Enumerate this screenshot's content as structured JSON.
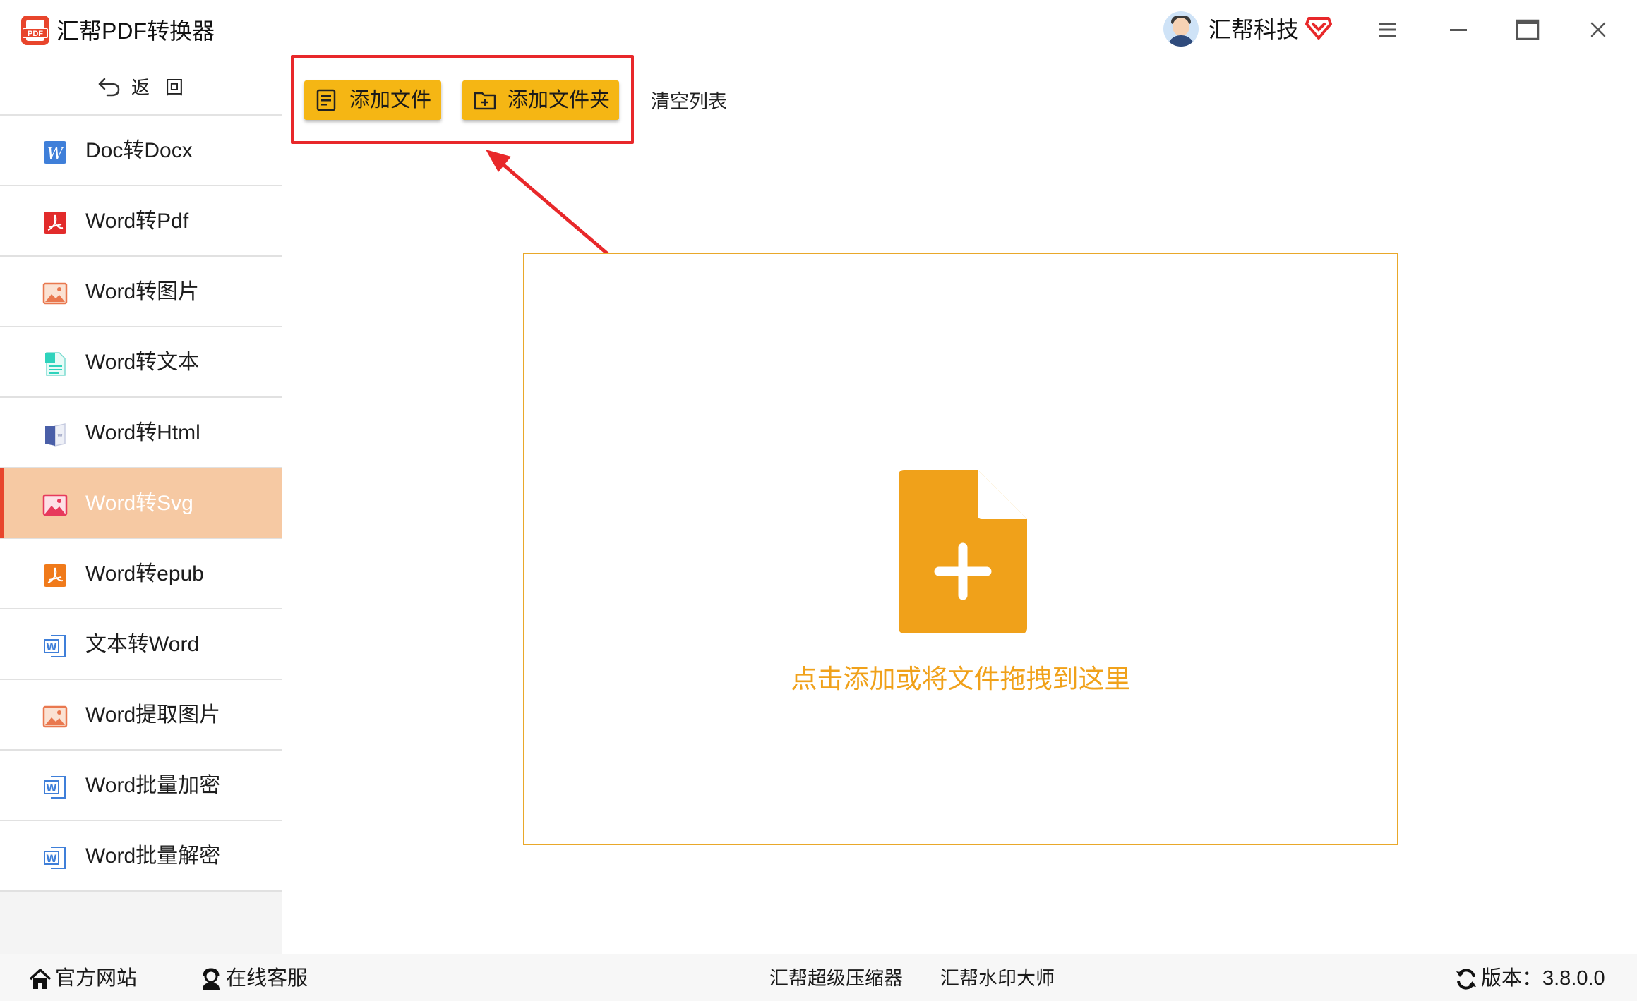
{
  "app": {
    "title": "汇帮PDF转换器",
    "logo_text": "PDF"
  },
  "user": {
    "name": "汇帮科技"
  },
  "sidebar": {
    "back_label": "返回",
    "items": [
      {
        "label": "Doc转Docx",
        "icon": "word-icon"
      },
      {
        "label": "Word转Pdf",
        "icon": "pdf-icon"
      },
      {
        "label": "Word转图片",
        "icon": "image-icon"
      },
      {
        "label": "Word转文本",
        "icon": "text-file-icon"
      },
      {
        "label": "Word转Html",
        "icon": "html-book-icon"
      },
      {
        "label": "Word转Svg",
        "icon": "image-icon",
        "active": true
      },
      {
        "label": "Word转epub",
        "icon": "epub-icon"
      },
      {
        "label": "文本转Word",
        "icon": "word-doc-icon"
      },
      {
        "label": "Word提取图片",
        "icon": "image-icon"
      },
      {
        "label": "Word批量加密",
        "icon": "word-doc-icon"
      },
      {
        "label": "Word批量解密",
        "icon": "word-doc-icon"
      }
    ]
  },
  "toolbar": {
    "add_file": "添加文件",
    "add_folder": "添加文件夹",
    "clear_list": "清空列表"
  },
  "dropzone": {
    "hint": "点击添加或将文件拖拽到这里"
  },
  "footer": {
    "official_site": "官方网站",
    "online_service": "在线客服",
    "compressor": "汇帮超级压缩器",
    "watermark": "汇帮水印大师",
    "version": "版本：3.8.0.0"
  },
  "colors": {
    "accent": "#f5b614",
    "active_item": "#f6c9a3",
    "highlight_red": "#e8282a",
    "drop_text": "#f0a11a"
  }
}
